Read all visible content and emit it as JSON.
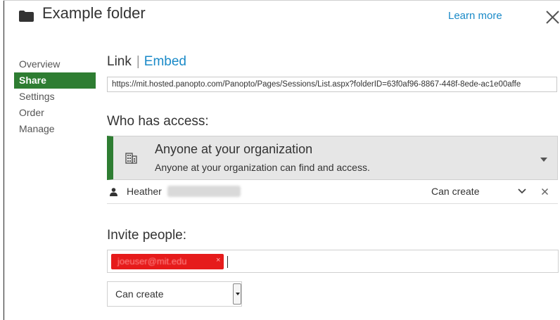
{
  "header": {
    "title": "Example folder",
    "learn_more": "Learn more",
    "folder_icon": "folder-icon",
    "close_icon": "close-icon"
  },
  "sidebar": {
    "items": [
      {
        "label": "Overview",
        "active": false
      },
      {
        "label": "Share",
        "active": true
      },
      {
        "label": "Settings",
        "active": false
      },
      {
        "label": "Order",
        "active": false
      },
      {
        "label": "Manage",
        "active": false
      }
    ]
  },
  "tabs": {
    "link": "Link",
    "separator": "|",
    "embed": "Embed"
  },
  "share_link": {
    "url": "https://mit.hosted.panopto.com/Panopto/Pages/Sessions/List.aspx?folderID=63f0af96-8867-448f-8ede-ac1e00affe"
  },
  "access": {
    "heading": "Who has access:",
    "option_title": "Anyone at your organization",
    "option_description": "Anyone at your organization can find and access.",
    "icon": "building-icon"
  },
  "users": [
    {
      "first_name": "Heather",
      "permission": "Can create"
    }
  ],
  "invite": {
    "heading": "Invite people:",
    "chip_email": "joeuser@mit.edu",
    "chip_remove": "×",
    "permission_selected": "Can create"
  },
  "colors": {
    "accent_green": "#2e7d32",
    "link_blue": "#1a8ac8",
    "chip_red": "#e61b1b"
  }
}
